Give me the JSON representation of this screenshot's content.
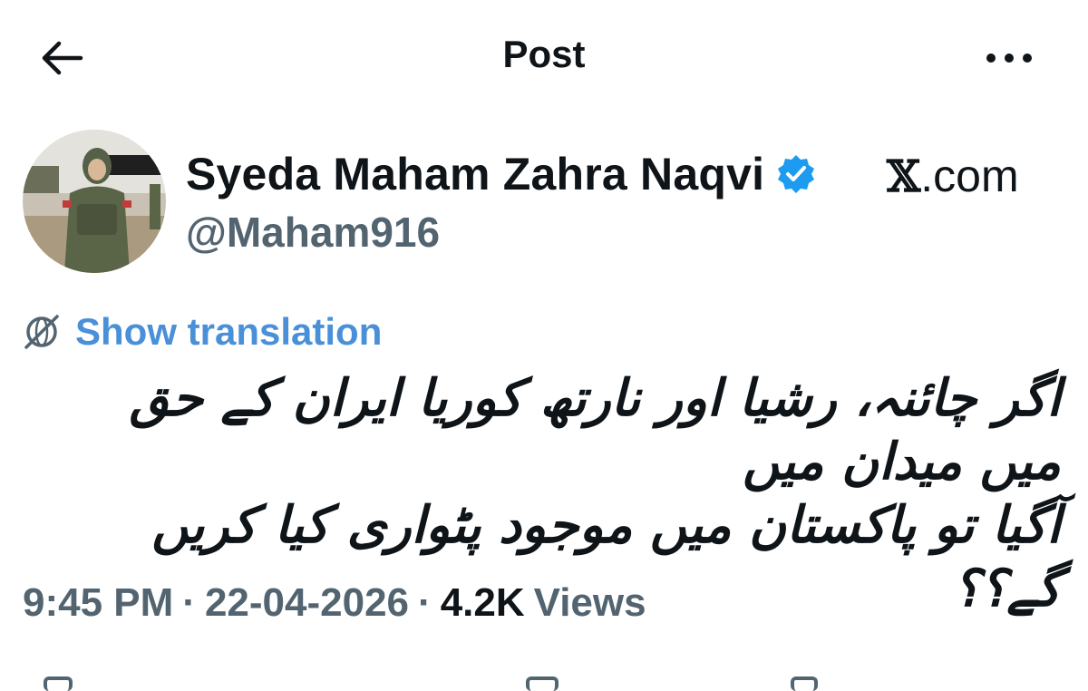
{
  "header": {
    "title": "Post",
    "back_icon": "arrow-left-icon",
    "more_icon": "more-horizontal-icon"
  },
  "author": {
    "display_name": "Syeda Maham Zahra Naqvi",
    "handle": "@Maham916",
    "verified": true,
    "verified_color": "#1d9bf0",
    "source_label_mark": "𝕏",
    "source_label_suffix": ".com"
  },
  "translation": {
    "label": "Show translation",
    "color": "#4a90d9",
    "icon": "translate-globe-icon"
  },
  "post": {
    "lines": [
      "اگر چائنہ، رشیا اور نارتھ کوریا ایران کے حق میں میدان میں",
      "آگیا تو پاکستان میں موجود پٹواری کیا کریں گے؟؟"
    ]
  },
  "meta": {
    "time": "9:45 PM",
    "separator": "·",
    "date": "22-04-2026",
    "views_count": "4.2K",
    "views_label": "Views"
  }
}
